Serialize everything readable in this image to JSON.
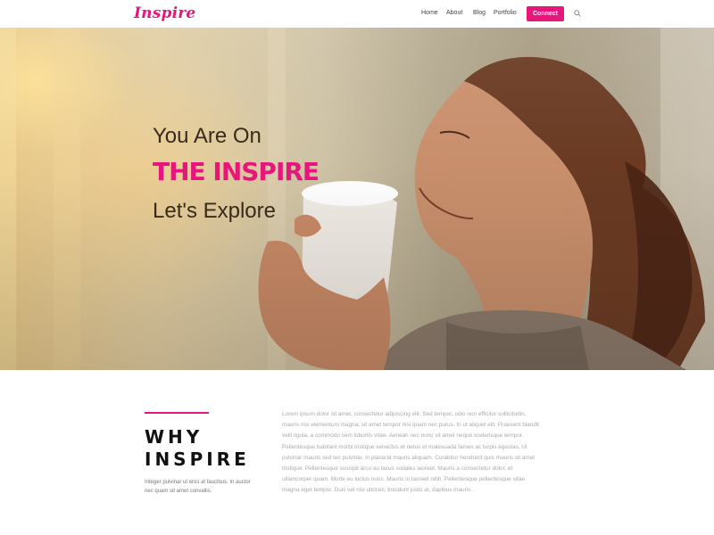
{
  "brand": {
    "logo": "Inspire",
    "accent_color": "#e6167d"
  },
  "nav": {
    "items": [
      "Home",
      "About",
      "Blog",
      "Portfolio"
    ],
    "connect_label": "Connect",
    "search_icon": "search-icon"
  },
  "hero": {
    "line1": "You Are On",
    "line2": "The Inspire",
    "line3": "Let's Explore"
  },
  "why": {
    "title_line1": "WHY",
    "title_line2": "INSPIRE",
    "small_text": "Integer pulvinar ut eros at faucibus. In auctor nec quam sit amet convallis.",
    "body_text": "Lorem ipsum dolor sit amet, consectetur adipiscing elit. Sed tempor, odio non efficitur sollicitudin, mauris nisi elementum magna, sit amet tempor nisi quam nec purus. In ut aliquet elit. Praesent blandit velit ligula, a commodo sem lobortis vitae. Aenean nec nunc sit amet neque scelerisque tempor. Pellentesque habitant morbi tristique senectus et netus et malesuada fames ac turpis egestas. Ut pulvinar mauris sed leo pulvinar, in placerat mauris aliquam. Curabitur hendrerit quis mauris sit amet tristique. Pellentesque suscipit arcu eu lacus sodales laoreet. Mauris a consectetur dolor, et ullamcorper quam. Morbi eu luctus nunc. Mauris in laoreet nibh. Pellentesque pellentesque vitae magna eget tempor. Duis vel nisl ultrices, tincidunt justo at, dapibus mauris."
  }
}
